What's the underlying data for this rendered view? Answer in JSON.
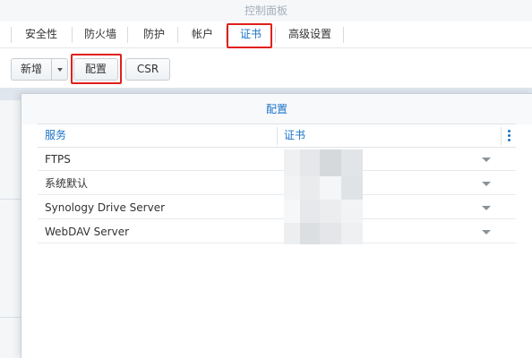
{
  "window": {
    "title": "控制面板"
  },
  "tabs": [
    {
      "label": "安全性"
    },
    {
      "label": "防火墙"
    },
    {
      "label": "防护"
    },
    {
      "label": "帐户"
    },
    {
      "label": "证书",
      "active": true
    },
    {
      "label": "高级设置"
    }
  ],
  "toolbar": {
    "new_label": "新增",
    "config_label": "配置",
    "csr_label": "CSR"
  },
  "dialog": {
    "title": "配置",
    "columns": {
      "service": "服务",
      "certificate": "证书"
    },
    "rows": [
      {
        "service": "FTPS"
      },
      {
        "service": "系统默认"
      },
      {
        "service": "Synology Drive Server"
      },
      {
        "service": "WebDAV Server"
      }
    ]
  },
  "colors": {
    "accent": "#1a73c8",
    "highlight": "#e0201b"
  }
}
